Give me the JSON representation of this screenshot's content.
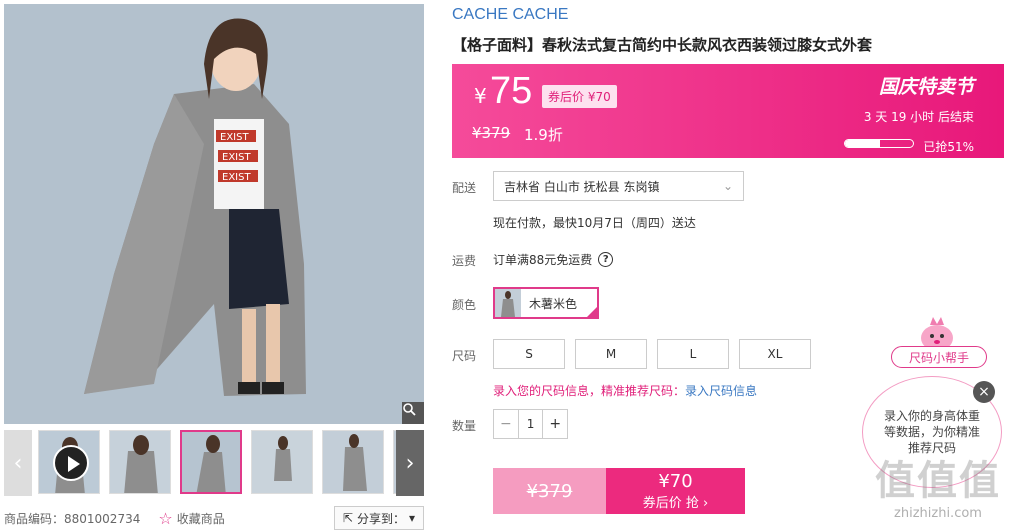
{
  "gallery": {
    "thumbnails": [
      {
        "name": "thumb-video"
      },
      {
        "name": "thumb-2"
      },
      {
        "name": "thumb-3"
      },
      {
        "name": "thumb-4"
      },
      {
        "name": "thumb-5"
      },
      {
        "name": "thumb-6"
      }
    ],
    "active_thumbnail_index": 2,
    "shirt_text": [
      "EXIST",
      "EXIST",
      "EXIST"
    ]
  },
  "meta": {
    "product_code": "商品编码：8801002734",
    "favorite_label": "收藏商品",
    "share_label": "分享到："
  },
  "product": {
    "brand": "CACHE CACHE",
    "title": "【格子面料】春秋法式复古简约中长款风衣西装领过膝女式外套"
  },
  "price_box": {
    "currency": "¥",
    "price": "75",
    "coupon_tag": "券后价 ¥70",
    "original_price": "¥379",
    "discount": "1.9折",
    "event": "国庆特卖节",
    "countdown": "3  天 19 小时 后结束",
    "sold_label": "已抢51%",
    "sold_percent": 51,
    "accent_color": "#ec2a7e"
  },
  "delivery": {
    "label": "配送",
    "address": "吉林省 白山市 抚松县 东岗镇",
    "note": "现在付款，最快10月7日（周四）送达"
  },
  "shipping": {
    "label": "运费",
    "text": "订单满88元免运费"
  },
  "color": {
    "label": "颜色",
    "option": "木薯米色"
  },
  "size": {
    "label": "尺码",
    "options": [
      "S",
      "M",
      "L",
      "XL"
    ],
    "tip_prefix": "录入您的尺码信息，精准推荐尺码：",
    "tip_link": "录入尺码信息"
  },
  "quantity": {
    "label": "数量",
    "minus": "−",
    "value": "1",
    "plus": "+"
  },
  "buy": {
    "original": "¥379",
    "price": "¥70",
    "action": "券后价 抢 ›"
  },
  "helper": {
    "label": "尺码小帮手",
    "bubble": "录入你的身高体重等数据，为你精准推荐尺码",
    "close": "×"
  },
  "watermark": {
    "big": "值值值",
    "small": "zhizhizhi.com"
  }
}
